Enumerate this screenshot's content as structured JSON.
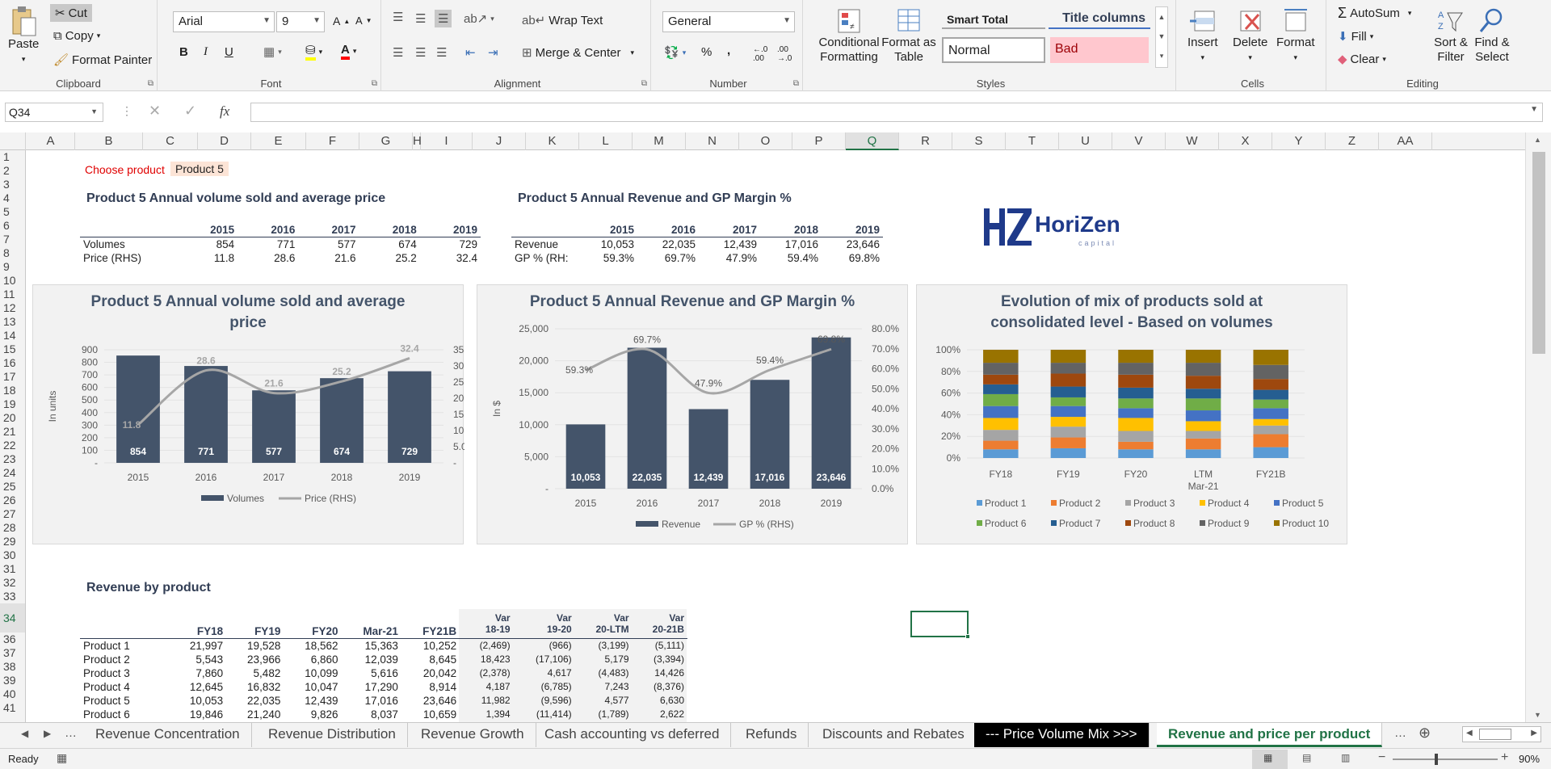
{
  "ribbon": {
    "clipboard": {
      "label": "Clipboard",
      "paste": "Paste",
      "cut": "Cut",
      "copy": "Copy",
      "format_painter": "Format Painter"
    },
    "font": {
      "label": "Font",
      "family": "Arial",
      "size": "9",
      "bold": "B",
      "italic": "I",
      "underline": "U"
    },
    "alignment": {
      "label": "Alignment",
      "wrap_text": "Wrap Text",
      "merge_center": "Merge & Center"
    },
    "number": {
      "label": "Number",
      "format": "General",
      "percent": "%",
      "comma": ","
    },
    "styles": {
      "label": "Styles",
      "conditional": "Conditional Formatting",
      "format_table": "Format as Table",
      "smart_total": "Smart Total",
      "title_columns": "Title columns",
      "normal": "Normal",
      "bad": "Bad"
    },
    "cells": {
      "label": "Cells",
      "insert": "Insert",
      "delete": "Delete",
      "format": "Format"
    },
    "editing": {
      "label": "Editing",
      "autosum": "AutoSum",
      "fill": "Fill",
      "clear": "Clear",
      "sort_filter": "Sort & Filter",
      "find_select": "Find & Select"
    }
  },
  "formula_bar": {
    "name_box": "Q34",
    "fx": "fx",
    "content": ""
  },
  "columns": [
    "A",
    "B",
    "C",
    "D",
    "E",
    "F",
    "G",
    "H",
    "I",
    "J",
    "K",
    "L",
    "M",
    "N",
    "O",
    "P",
    "Q",
    "R",
    "S",
    "T",
    "U",
    "V",
    "W",
    "X",
    "Y",
    "Z",
    "AA"
  ],
  "rows": [
    "1",
    "2",
    "3",
    "4",
    "5",
    "6",
    "7",
    "8",
    "9",
    "10",
    "11",
    "12",
    "13",
    "14",
    "15",
    "16",
    "17",
    "18",
    "19",
    "20",
    "21",
    "22",
    "23",
    "24",
    "25",
    "26",
    "27",
    "28",
    "29",
    "30",
    "31",
    "32",
    "33",
    "34",
    "36",
    "37",
    "38",
    "39",
    "40",
    "41"
  ],
  "selected_column": "Q",
  "selected_row": "34",
  "sheet": {
    "choose_label": "Choose product",
    "choose_value": "Product 5",
    "vol_heading": "Product 5 Annual volume sold and average price",
    "rev_heading": "Product 5 Annual Revenue and GP Margin %",
    "years": [
      "2015",
      "2016",
      "2017",
      "2018",
      "2019"
    ],
    "vol_table": {
      "row1_label": "Volumes",
      "row1": [
        "854",
        "771",
        "577",
        "674",
        "729"
      ],
      "row2_label": "Price (RHS)",
      "row2": [
        "11.8",
        "28.6",
        "21.6",
        "25.2",
        "32.4"
      ]
    },
    "rev_table": {
      "row1_label": "Revenue",
      "row1": [
        "10,053",
        "22,035",
        "12,439",
        "17,016",
        "23,646"
      ],
      "row2_label": "GP % (RH:",
      "row2": [
        "59.3%",
        "69.7%",
        "47.9%",
        "59.4%",
        "69.8%"
      ]
    },
    "logo": {
      "name_a": "Hori",
      "name_b": "Zen",
      "sub": "capital",
      "mark": "HZ"
    },
    "rbp_heading": "Revenue by product",
    "rbp_headers": [
      "FY18",
      "FY19",
      "FY20",
      "Mar-21",
      "FY21B",
      "Var\n18-19",
      "Var\n19-20",
      "Var\n20-LTM",
      "Var\n20-21B"
    ],
    "rbp_rows": [
      {
        "label": "Product 1",
        "vals": [
          "21,997",
          "19,528",
          "18,562",
          "15,363",
          "10,252",
          "(2,469)",
          "(966)",
          "(3,199)",
          "(5,111)"
        ]
      },
      {
        "label": "Product 2",
        "vals": [
          "5,543",
          "23,966",
          "6,860",
          "12,039",
          "8,645",
          "18,423",
          "(17,106)",
          "5,179",
          "(3,394)"
        ]
      },
      {
        "label": "Product 3",
        "vals": [
          "7,860",
          "5,482",
          "10,099",
          "5,616",
          "20,042",
          "(2,378)",
          "4,617",
          "(4,483)",
          "14,426"
        ]
      },
      {
        "label": "Product 4",
        "vals": [
          "12,645",
          "16,832",
          "10,047",
          "17,290",
          "8,914",
          "4,187",
          "(6,785)",
          "7,243",
          "(8,376)"
        ]
      },
      {
        "label": "Product 5",
        "vals": [
          "10,053",
          "22,035",
          "12,439",
          "17,016",
          "23,646",
          "11,982",
          "(9,596)",
          "4,577",
          "6,630"
        ]
      },
      {
        "label": "Product 6",
        "vals": [
          "19,846",
          "21,240",
          "9,826",
          "8,037",
          "10,659",
          "1,394",
          "(11,414)",
          "(1,789)",
          "2,622"
        ]
      }
    ]
  },
  "chart_data": [
    {
      "type": "bar",
      "title": "Product 5 Annual volume sold and average price",
      "categories": [
        "2015",
        "2016",
        "2017",
        "2018",
        "2019"
      ],
      "series": [
        {
          "name": "Volumes",
          "type": "bar",
          "axis": "left",
          "values": [
            854,
            771,
            577,
            674,
            729
          ]
        },
        {
          "name": "Price (RHS)",
          "type": "line",
          "axis": "right",
          "values": [
            11.8,
            28.6,
            21.6,
            25.2,
            32.4
          ]
        }
      ],
      "ylabel": "In units",
      "ylim": [
        0,
        900
      ],
      "y_ticks": [
        "-",
        "100",
        "200",
        "300",
        "400",
        "500",
        "600",
        "700",
        "800",
        "900"
      ],
      "y2lim": [
        0,
        35
      ],
      "y2_ticks": [
        "-",
        "5.0",
        "10.0",
        "15.0",
        "20.0",
        "25.0",
        "30.0",
        "35.0"
      ],
      "colors": {
        "bar": "#44546a",
        "line": "#a6a6a6"
      },
      "legend": "bottom"
    },
    {
      "type": "bar",
      "title": "Product 5 Annual Revenue and GP Margin %",
      "categories": [
        "2015",
        "2016",
        "2017",
        "2018",
        "2019"
      ],
      "series": [
        {
          "name": "Revenue",
          "type": "bar",
          "axis": "left",
          "values": [
            10053,
            22035,
            12439,
            17016,
            23646
          ]
        },
        {
          "name": "GP % (RHS)",
          "type": "line",
          "axis": "right",
          "values": [
            59.3,
            69.7,
            47.9,
            59.4,
            69.8
          ]
        }
      ],
      "ylabel": "In $",
      "ylim": [
        0,
        25000
      ],
      "y_ticks": [
        "-",
        "5,000",
        "10,000",
        "15,000",
        "20,000",
        "25,000"
      ],
      "y2lim": [
        0,
        80
      ],
      "y2_ticks": [
        "0.0%",
        "10.0%",
        "20.0%",
        "30.0%",
        "40.0%",
        "50.0%",
        "60.0%",
        "70.0%",
        "80.0%"
      ],
      "bar_labels": [
        "10,053",
        "22,035",
        "12,439",
        "17,016",
        "23,646"
      ],
      "line_labels": [
        "59.3%",
        "69.7%",
        "47.9%",
        "59.4%",
        "69.8%"
      ],
      "colors": {
        "bar": "#44546a",
        "line": "#a6a6a6"
      },
      "legend": "bottom"
    },
    {
      "type": "bar",
      "stacked": true,
      "title": "Evolution of mix of products sold at consolidated level - Based on volumes",
      "categories": [
        "FY18",
        "FY19",
        "FY20",
        "LTM Mar-21",
        "FY21B"
      ],
      "ylim": [
        0,
        100
      ],
      "y_ticks": [
        "0%",
        "20%",
        "40%",
        "60%",
        "80%",
        "100%"
      ],
      "series": [
        {
          "name": "Product 1",
          "color": "#5b9bd5",
          "values": [
            8,
            9,
            8,
            8,
            10
          ]
        },
        {
          "name": "Product 2",
          "color": "#ed7d31",
          "values": [
            8,
            10,
            7,
            10,
            12
          ]
        },
        {
          "name": "Product 3",
          "color": "#a5a5a5",
          "values": [
            10,
            10,
            10,
            7,
            8
          ]
        },
        {
          "name": "Product 4",
          "color": "#ffc000",
          "values": [
            11,
            9,
            12,
            9,
            6
          ]
        },
        {
          "name": "Product 5",
          "color": "#4472c4",
          "values": [
            11,
            10,
            9,
            10,
            10
          ]
        },
        {
          "name": "Product 6",
          "color": "#70ad47",
          "values": [
            11,
            8,
            9,
            11,
            8
          ]
        },
        {
          "name": "Product 7",
          "color": "#255e91",
          "values": [
            9,
            10,
            10,
            9,
            9
          ]
        },
        {
          "name": "Product 8",
          "color": "#9e480e",
          "values": [
            9,
            12,
            12,
            12,
            10
          ]
        },
        {
          "name": "Product 9",
          "color": "#636363",
          "values": [
            11,
            10,
            11,
            12,
            13
          ]
        },
        {
          "name": "Product 10",
          "color": "#997300",
          "values": [
            12,
            12,
            12,
            12,
            14
          ]
        }
      ],
      "legend": "bottom"
    }
  ],
  "tabs": [
    "Revenue Concentration",
    "Revenue Distribution",
    "Revenue Growth",
    "Cash accounting vs deferred",
    "Refunds",
    "Discounts and Rebates",
    "--- Price Volume Mix >>>",
    "Revenue and price per product"
  ],
  "status": {
    "ready": "Ready",
    "zoom": "90%"
  }
}
